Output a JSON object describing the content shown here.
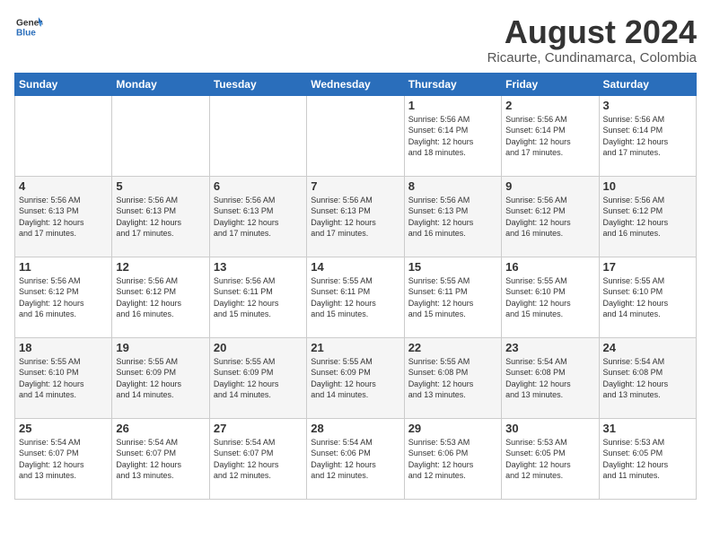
{
  "header": {
    "logo_line1": "General",
    "logo_line2": "Blue",
    "month": "August 2024",
    "location": "Ricaurte, Cundinamarca, Colombia"
  },
  "weekdays": [
    "Sunday",
    "Monday",
    "Tuesday",
    "Wednesday",
    "Thursday",
    "Friday",
    "Saturday"
  ],
  "weeks": [
    [
      {
        "day": "",
        "info": ""
      },
      {
        "day": "",
        "info": ""
      },
      {
        "day": "",
        "info": ""
      },
      {
        "day": "",
        "info": ""
      },
      {
        "day": "1",
        "info": "Sunrise: 5:56 AM\nSunset: 6:14 PM\nDaylight: 12 hours\nand 18 minutes."
      },
      {
        "day": "2",
        "info": "Sunrise: 5:56 AM\nSunset: 6:14 PM\nDaylight: 12 hours\nand 17 minutes."
      },
      {
        "day": "3",
        "info": "Sunrise: 5:56 AM\nSunset: 6:14 PM\nDaylight: 12 hours\nand 17 minutes."
      }
    ],
    [
      {
        "day": "4",
        "info": "Sunrise: 5:56 AM\nSunset: 6:13 PM\nDaylight: 12 hours\nand 17 minutes."
      },
      {
        "day": "5",
        "info": "Sunrise: 5:56 AM\nSunset: 6:13 PM\nDaylight: 12 hours\nand 17 minutes."
      },
      {
        "day": "6",
        "info": "Sunrise: 5:56 AM\nSunset: 6:13 PM\nDaylight: 12 hours\nand 17 minutes."
      },
      {
        "day": "7",
        "info": "Sunrise: 5:56 AM\nSunset: 6:13 PM\nDaylight: 12 hours\nand 17 minutes."
      },
      {
        "day": "8",
        "info": "Sunrise: 5:56 AM\nSunset: 6:13 PM\nDaylight: 12 hours\nand 16 minutes."
      },
      {
        "day": "9",
        "info": "Sunrise: 5:56 AM\nSunset: 6:12 PM\nDaylight: 12 hours\nand 16 minutes."
      },
      {
        "day": "10",
        "info": "Sunrise: 5:56 AM\nSunset: 6:12 PM\nDaylight: 12 hours\nand 16 minutes."
      }
    ],
    [
      {
        "day": "11",
        "info": "Sunrise: 5:56 AM\nSunset: 6:12 PM\nDaylight: 12 hours\nand 16 minutes."
      },
      {
        "day": "12",
        "info": "Sunrise: 5:56 AM\nSunset: 6:12 PM\nDaylight: 12 hours\nand 16 minutes."
      },
      {
        "day": "13",
        "info": "Sunrise: 5:56 AM\nSunset: 6:11 PM\nDaylight: 12 hours\nand 15 minutes."
      },
      {
        "day": "14",
        "info": "Sunrise: 5:55 AM\nSunset: 6:11 PM\nDaylight: 12 hours\nand 15 minutes."
      },
      {
        "day": "15",
        "info": "Sunrise: 5:55 AM\nSunset: 6:11 PM\nDaylight: 12 hours\nand 15 minutes."
      },
      {
        "day": "16",
        "info": "Sunrise: 5:55 AM\nSunset: 6:10 PM\nDaylight: 12 hours\nand 15 minutes."
      },
      {
        "day": "17",
        "info": "Sunrise: 5:55 AM\nSunset: 6:10 PM\nDaylight: 12 hours\nand 14 minutes."
      }
    ],
    [
      {
        "day": "18",
        "info": "Sunrise: 5:55 AM\nSunset: 6:10 PM\nDaylight: 12 hours\nand 14 minutes."
      },
      {
        "day": "19",
        "info": "Sunrise: 5:55 AM\nSunset: 6:09 PM\nDaylight: 12 hours\nand 14 minutes."
      },
      {
        "day": "20",
        "info": "Sunrise: 5:55 AM\nSunset: 6:09 PM\nDaylight: 12 hours\nand 14 minutes."
      },
      {
        "day": "21",
        "info": "Sunrise: 5:55 AM\nSunset: 6:09 PM\nDaylight: 12 hours\nand 14 minutes."
      },
      {
        "day": "22",
        "info": "Sunrise: 5:55 AM\nSunset: 6:08 PM\nDaylight: 12 hours\nand 13 minutes."
      },
      {
        "day": "23",
        "info": "Sunrise: 5:54 AM\nSunset: 6:08 PM\nDaylight: 12 hours\nand 13 minutes."
      },
      {
        "day": "24",
        "info": "Sunrise: 5:54 AM\nSunset: 6:08 PM\nDaylight: 12 hours\nand 13 minutes."
      }
    ],
    [
      {
        "day": "25",
        "info": "Sunrise: 5:54 AM\nSunset: 6:07 PM\nDaylight: 12 hours\nand 13 minutes."
      },
      {
        "day": "26",
        "info": "Sunrise: 5:54 AM\nSunset: 6:07 PM\nDaylight: 12 hours\nand 13 minutes."
      },
      {
        "day": "27",
        "info": "Sunrise: 5:54 AM\nSunset: 6:07 PM\nDaylight: 12 hours\nand 12 minutes."
      },
      {
        "day": "28",
        "info": "Sunrise: 5:54 AM\nSunset: 6:06 PM\nDaylight: 12 hours\nand 12 minutes."
      },
      {
        "day": "29",
        "info": "Sunrise: 5:53 AM\nSunset: 6:06 PM\nDaylight: 12 hours\nand 12 minutes."
      },
      {
        "day": "30",
        "info": "Sunrise: 5:53 AM\nSunset: 6:05 PM\nDaylight: 12 hours\nand 12 minutes."
      },
      {
        "day": "31",
        "info": "Sunrise: 5:53 AM\nSunset: 6:05 PM\nDaylight: 12 hours\nand 11 minutes."
      }
    ]
  ]
}
